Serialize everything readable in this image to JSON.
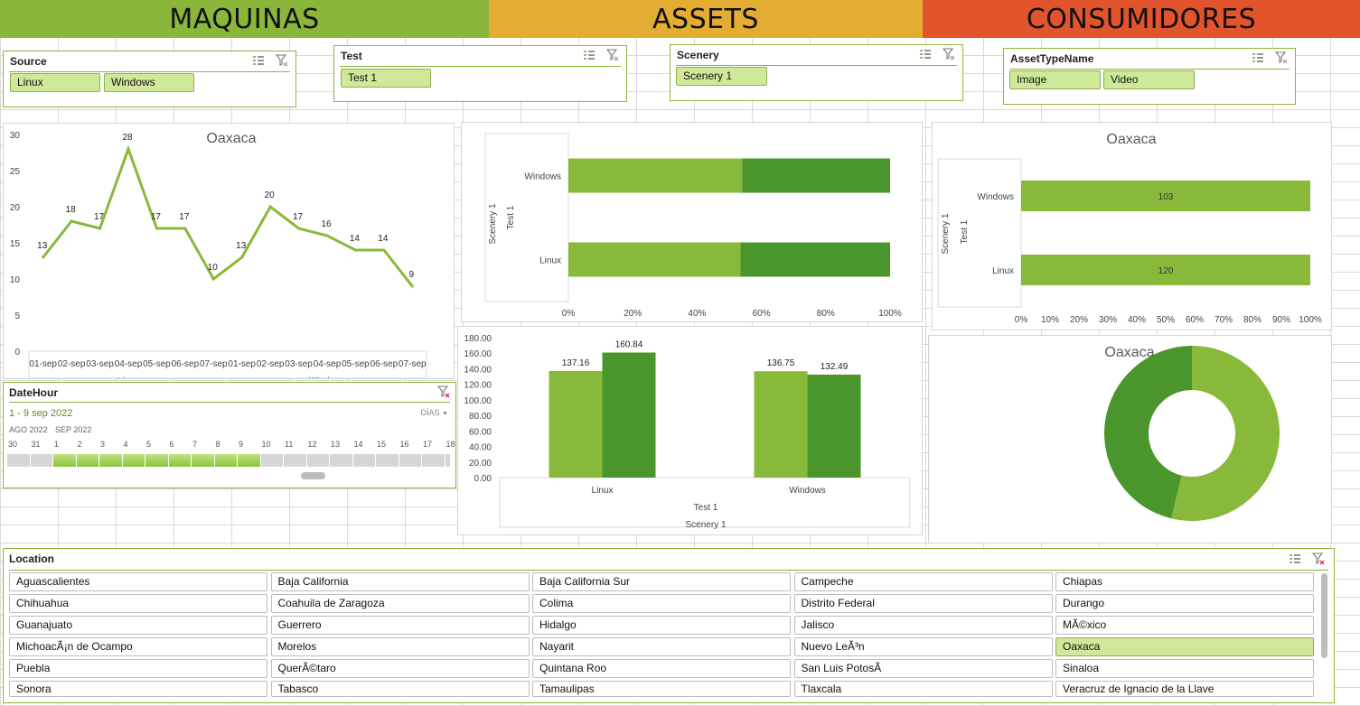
{
  "headers": {
    "maquinas": "MAQUINAS",
    "assets": "ASSETS",
    "consumidores": "CONSUMIDORES"
  },
  "colors": {
    "green_header": "#8ab63a",
    "orange_header": "#e3ad32",
    "red_header": "#e2542b",
    "light_green": "#88b93a",
    "dark_green": "#4a962c",
    "chip_fill": "#cfe89a"
  },
  "slicers": {
    "source": {
      "title": "Source",
      "items": [
        "Linux",
        "Windows"
      ],
      "selected": [
        "Linux",
        "Windows"
      ]
    },
    "test": {
      "title": "Test",
      "items": [
        "Test 1"
      ],
      "selected": [
        "Test 1"
      ]
    },
    "scenery": {
      "title": "Scenery",
      "items": [
        "Scenery 1"
      ],
      "selected": [
        "Scenery 1"
      ]
    },
    "asset_type": {
      "title": "AssetTypeName",
      "items": [
        "Image",
        "Video"
      ],
      "selected": [
        "Image",
        "Video"
      ]
    }
  },
  "timeline": {
    "title": "DateHour",
    "range_label": "1 - 9 sep 2022",
    "level": "DÍAS",
    "month1": "AGO 2022",
    "month2": "SEP 2022",
    "days": [
      "30",
      "31",
      "1",
      "2",
      "3",
      "4",
      "5",
      "6",
      "7",
      "8",
      "9",
      "10",
      "11",
      "12",
      "13",
      "14",
      "15",
      "16",
      "17",
      "18"
    ],
    "selected_days": [
      "1",
      "2",
      "3",
      "4",
      "5",
      "6",
      "7",
      "8",
      "9"
    ]
  },
  "location": {
    "title": "Location",
    "items": [
      "Aguascalientes",
      "Baja California",
      "Baja California  Sur",
      "Campeche",
      "Chiapas",
      "Chihuahua",
      "Coahuila de Zaragoza",
      "Colima",
      "Distrito  Federal",
      "Durango",
      "Guanajuato",
      "Guerrero",
      "Hidalgo",
      "Jalisco",
      "MÃ©xico",
      "MichoacÃ¡n  de Ocampo",
      "Morelos",
      "Nayarit",
      "Nuevo LeÃ³n",
      "Oaxaca",
      "Puebla",
      "QuerÃ©taro",
      "Quintana Roo",
      "San Luis PotosÃ",
      "Sinaloa",
      "Sonora",
      "Tabasco",
      "Tamaulipas",
      "Tlaxcala",
      "Veracruz de Ignacio de la Llave"
    ],
    "selected": "Oaxaca"
  },
  "chart_data": [
    {
      "id": "line",
      "type": "line",
      "title": "Oaxaca",
      "x": [
        "01-sep",
        "02-sep",
        "03-sep",
        "04-sep",
        "05-sep",
        "06-sep",
        "07-sep",
        "01-sep",
        "02-sep",
        "03-sep",
        "04-sep",
        "05-sep",
        "06-sep",
        "07-sep"
      ],
      "groups": [
        "Linux",
        "Windows"
      ],
      "values": [
        13,
        18,
        17,
        28,
        17,
        17,
        10,
        13,
        20,
        17,
        16,
        14,
        14,
        9
      ],
      "ylim": [
        0,
        30
      ],
      "yticks": [
        0,
        5,
        10,
        15,
        20,
        25,
        30
      ],
      "color": "#88b93a"
    },
    {
      "id": "stacked100",
      "type": "bar",
      "orientation": "horizontal",
      "stacked": "percent",
      "categories": [
        "Windows",
        "Linux"
      ],
      "series": [
        {
          "values": [
            54,
            53.5
          ],
          "color": "#88b93a"
        },
        {
          "values": [
            46,
            46.5
          ],
          "color": "#4a962c"
        }
      ],
      "xticks": [
        "0%",
        "20%",
        "40%",
        "60%",
        "80%",
        "100%"
      ],
      "axis_labels": [
        "Scenery 1",
        "Test 1"
      ]
    },
    {
      "id": "consum_bar",
      "type": "bar",
      "orientation": "horizontal",
      "stacked": "percent",
      "title": "Oaxaca",
      "categories": [
        "Windows",
        "Linux"
      ],
      "values": [
        103,
        120
      ],
      "color": "#88b93a",
      "xticks": [
        "0%",
        "10%",
        "20%",
        "30%",
        "40%",
        "50%",
        "60%",
        "70%",
        "80%",
        "90%",
        "100%"
      ],
      "axis_labels": [
        "Scenery 1",
        "Test 1"
      ]
    },
    {
      "id": "column",
      "type": "bar",
      "categories": [
        "Linux",
        "Windows"
      ],
      "series": [
        {
          "values": [
            137.16,
            136.75
          ],
          "color": "#88b93a"
        },
        {
          "values": [
            160.84,
            132.49
          ],
          "color": "#4a962c"
        }
      ],
      "labels": [
        [
          "137.16",
          "160.84"
        ],
        [
          "136.75",
          "132.49"
        ]
      ],
      "ylim": [
        0,
        180
      ],
      "yticks": [
        "0.00",
        "20.00",
        "40.00",
        "60.00",
        "80.00",
        "100.00",
        "120.00",
        "140.00",
        "160.00",
        "180.00"
      ],
      "axis_labels": [
        "Test 1",
        "Scenery 1"
      ]
    },
    {
      "id": "donut",
      "type": "pie",
      "title": "Oaxaca",
      "slices": [
        {
          "value": 53.8,
          "color": "#88b93a"
        },
        {
          "value": 46.2,
          "color": "#4a962c"
        }
      ]
    }
  ]
}
